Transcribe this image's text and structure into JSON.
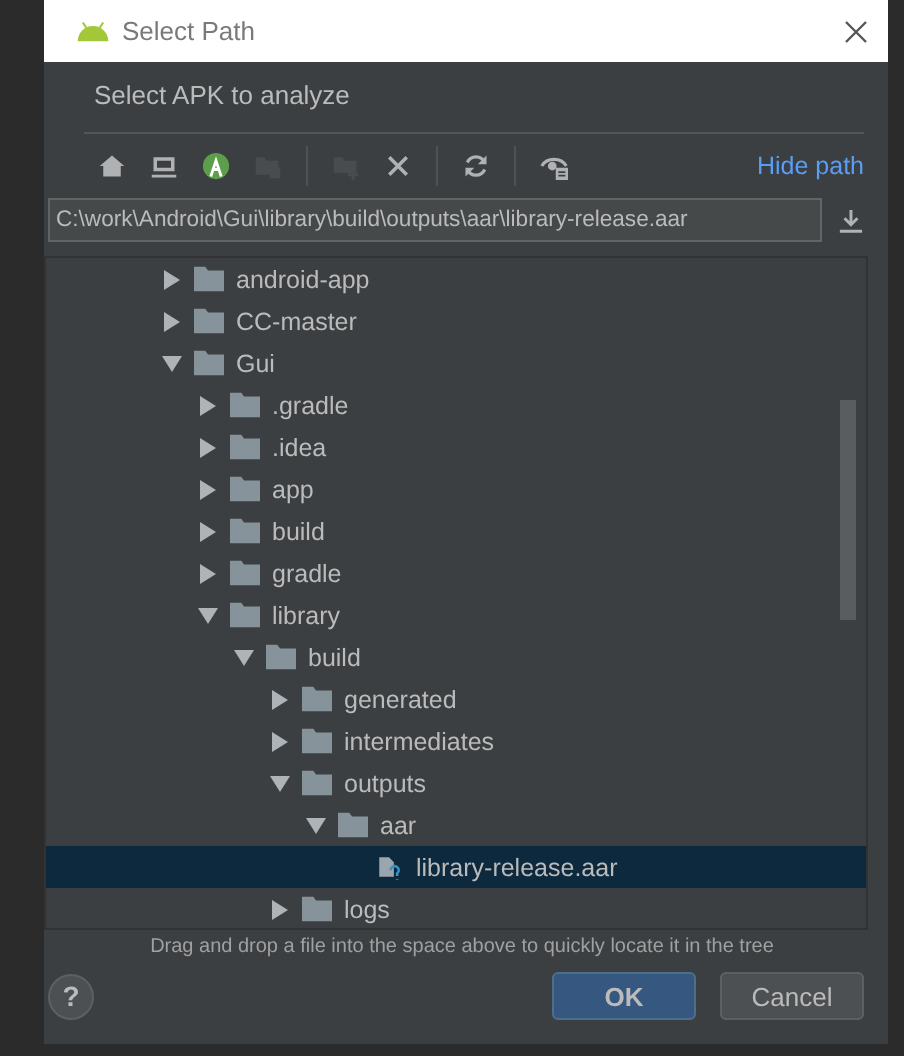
{
  "window": {
    "title": "Select Path"
  },
  "prompt": "Select APK to analyze",
  "toolbar": [
    {
      "kind": "home",
      "disabled": false
    },
    {
      "kind": "desktop",
      "disabled": false
    },
    {
      "kind": "android",
      "disabled": false
    },
    {
      "kind": "module",
      "disabled": true
    },
    {
      "kind": "sep"
    },
    {
      "kind": "newfolder",
      "disabled": true
    },
    {
      "kind": "delete",
      "disabled": false
    },
    {
      "kind": "sep"
    },
    {
      "kind": "refresh",
      "disabled": false
    },
    {
      "kind": "sep"
    },
    {
      "kind": "hidden",
      "disabled": false
    }
  ],
  "hide_path_link": "Hide path",
  "path_field": {
    "value": "C:\\work\\Android\\Gui\\library\\build\\outputs\\aar\\library-release.aar"
  },
  "tree": [
    {
      "label": "android-app",
      "kind": "folder",
      "expanded": false,
      "selected": false
    },
    {
      "label": "CC-master",
      "kind": "folder",
      "expanded": false,
      "selected": false
    },
    {
      "label": "Gui",
      "kind": "folder",
      "expanded": true,
      "selected": false,
      "children": [
        {
          "label": ".gradle",
          "kind": "folder",
          "expanded": false,
          "selected": false
        },
        {
          "label": ".idea",
          "kind": "folder",
          "expanded": false,
          "selected": false
        },
        {
          "label": "app",
          "kind": "folder",
          "expanded": false,
          "selected": false
        },
        {
          "label": "build",
          "kind": "folder",
          "expanded": false,
          "selected": false
        },
        {
          "label": "gradle",
          "kind": "folder",
          "expanded": false,
          "selected": false
        },
        {
          "label": "library",
          "kind": "folder",
          "expanded": true,
          "selected": false,
          "children": [
            {
              "label": "build",
              "kind": "folder",
              "expanded": true,
              "selected": false,
              "children": [
                {
                  "label": "generated",
                  "kind": "folder",
                  "expanded": false,
                  "selected": false
                },
                {
                  "label": "intermediates",
                  "kind": "folder",
                  "expanded": false,
                  "selected": false
                },
                {
                  "label": "outputs",
                  "kind": "folder",
                  "expanded": true,
                  "selected": false,
                  "children": [
                    {
                      "label": "aar",
                      "kind": "folder",
                      "expanded": true,
                      "selected": false,
                      "children": [
                        {
                          "label": "library-release.aar",
                          "kind": "file",
                          "selected": true
                        }
                      ]
                    }
                  ]
                },
                {
                  "label": "logs",
                  "kind": "folder",
                  "expanded": false,
                  "selected": false
                }
              ]
            }
          ]
        }
      ]
    }
  ],
  "hint": "Drag and drop a file into the space above to quickly locate it in the tree",
  "help_button": "?",
  "buttons": [
    {
      "label": "OK",
      "kind": "primary"
    },
    {
      "label": "Cancel",
      "kind": "normal"
    }
  ]
}
